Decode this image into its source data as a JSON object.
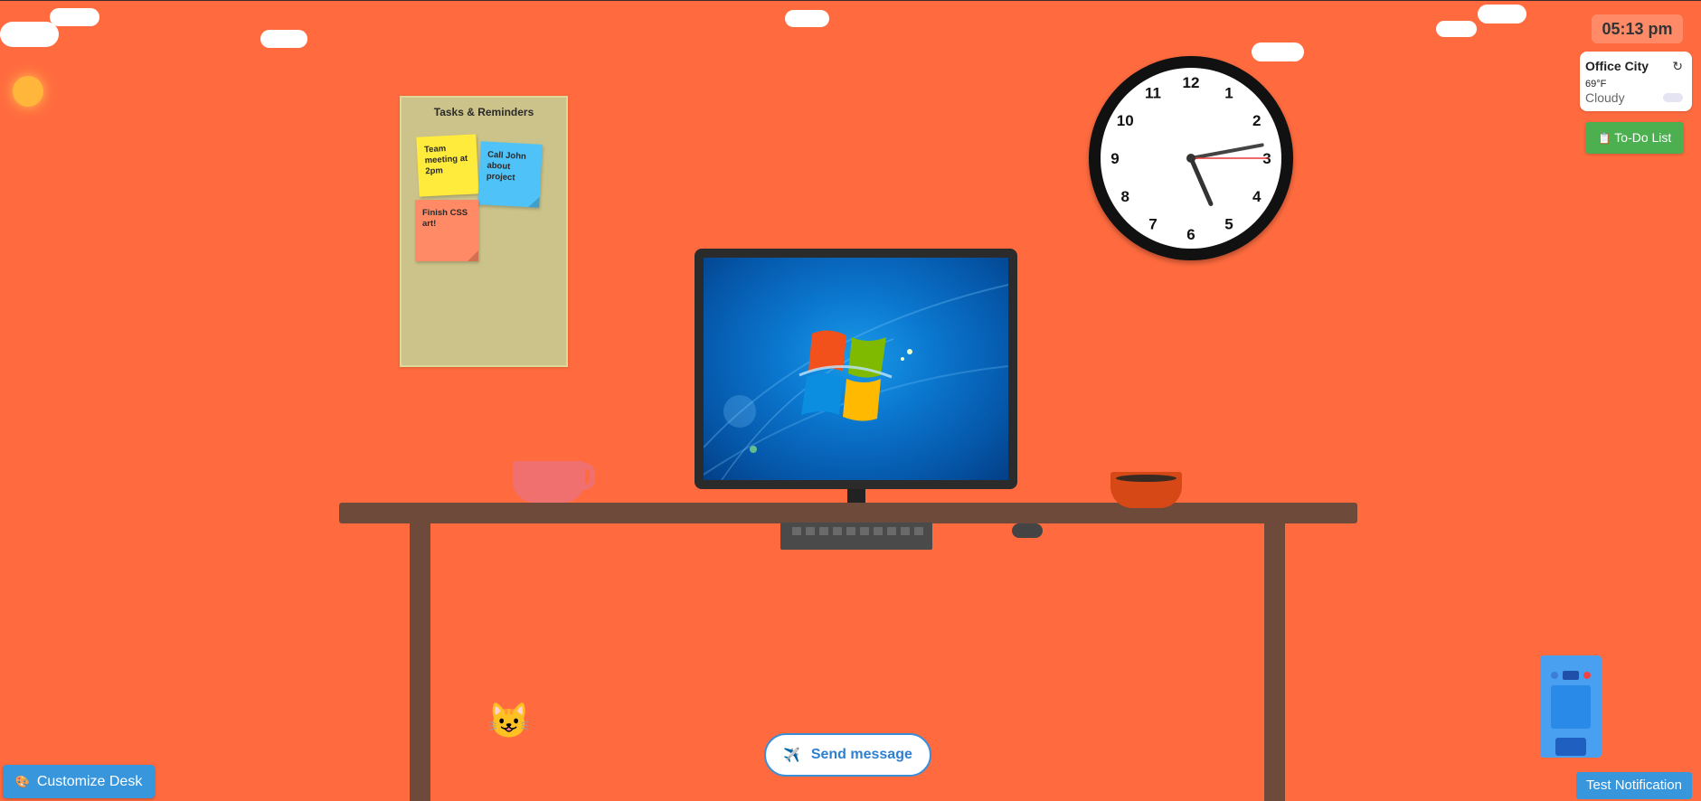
{
  "board": {
    "title": "Tasks & Reminders",
    "notes": [
      {
        "text": "Team meeting at 2pm",
        "color": "#ffeb3b"
      },
      {
        "text": "Call John about project",
        "color": "#4fc3f7"
      },
      {
        "text": "Finish CSS art!",
        "color": "#ff8a65"
      }
    ]
  },
  "clock": {
    "numbers": [
      "12",
      "1",
      "2",
      "3",
      "4",
      "5",
      "6",
      "7",
      "8",
      "9",
      "10",
      "11"
    ],
    "hour": 5,
    "minute": 13,
    "second": 15
  },
  "time_display": "05:13 pm",
  "weather": {
    "city": "Office City",
    "refresh_icon": "↻",
    "temp": "69°F",
    "condition": "Cloudy",
    "icon": "cloud-icon"
  },
  "todo_button": {
    "icon": "📋",
    "label": "To-Do List"
  },
  "send_button": {
    "icon": "✈️",
    "label": "Send message"
  },
  "customize_button": {
    "icon": "🎨",
    "label": "Customize Desk"
  },
  "notify_button": {
    "label": "Test Notification"
  },
  "cat": {
    "emoji": "😺"
  },
  "colors": {
    "wall": "#ff6b3f",
    "desk": "#6e4a3a",
    "accent_blue": "#3796dc",
    "todo_green": "#4caf50"
  }
}
